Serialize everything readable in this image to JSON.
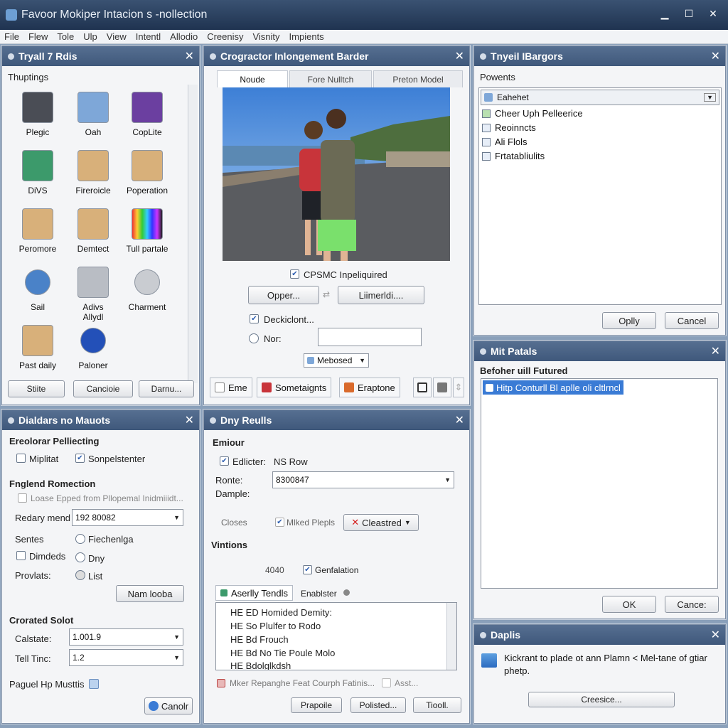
{
  "window": {
    "title": "Favoor Mokiper Intacion s -nollection",
    "minimize": "▁",
    "maximize": "☐",
    "close": "✕"
  },
  "menu": [
    "File",
    "Flew",
    "Tole",
    "Ulp",
    "View",
    "Intentl",
    "Allodio",
    "Creenisy",
    "Visnity",
    "Impients"
  ],
  "colors": {
    "titlebar": "#2a4060",
    "panel_header": "#4a6486",
    "selection": "#3a7bd5"
  },
  "p1": {
    "title": "Tryall 7 Rdis",
    "section": "Thuptings",
    "tiles": [
      {
        "label": "Plegic",
        "icon": "tool-icon",
        "color": "#4a4d55"
      },
      {
        "label": "Oah",
        "icon": "monitor-icon",
        "color": "#7ea7d8"
      },
      {
        "label": "CopLite",
        "icon": "purple-app-icon",
        "color": "#6b3fa0"
      },
      {
        "label": "DiVS",
        "icon": "window-icon",
        "color": "#3c9a6b"
      },
      {
        "label": "Fireroicle",
        "icon": "folder-icon",
        "color": "#d8b07a"
      },
      {
        "label": "Poperation",
        "icon": "folder-icon",
        "color": "#d8b07a"
      },
      {
        "label": "Peromore",
        "icon": "folder-icon",
        "color": "#d8b07a"
      },
      {
        "label": "Demtect",
        "icon": "folder-icon",
        "color": "#d8b07a"
      },
      {
        "label": "Tull partale",
        "icon": "color-bars-icon",
        "color": "#5a6bd8"
      },
      {
        "label": "Sail",
        "icon": "refresh-icon",
        "color": "#4a82c8"
      },
      {
        "label": "Adivs Allydl",
        "icon": "server-icon",
        "color": "#b9bdc4"
      },
      {
        "label": "Charment",
        "icon": "gauge-icon",
        "color": "#c9ccd1"
      },
      {
        "label": "Past daily",
        "icon": "folder-icon",
        "color": "#d8b07a"
      },
      {
        "label": "Paloner",
        "icon": "globe-icon",
        "color": "#2350b8"
      }
    ],
    "buttons": [
      "Stiite",
      "Cancioie",
      "Darnu..."
    ]
  },
  "p2": {
    "title": "Crogractor Inlongement Barder",
    "tabs": [
      "Noude",
      "Fore Nulltch",
      "Preton Model"
    ],
    "check1": "CPSMC Inpeliquired",
    "btn_open": "Opper...",
    "btn_limit": "Liimerldi....",
    "arrows": "⇄",
    "check2": "Deckiclont...",
    "radio_label": "Nor:",
    "combo": "Mebosed",
    "bottom_buttons": [
      {
        "label": "Eme",
        "icon": "page-icon"
      },
      {
        "label": "Sometaignts",
        "icon": "flag-icon"
      },
      {
        "label": "Eraptone",
        "icon": "image-icon"
      }
    ],
    "icon_buttons": [
      "square-icon",
      "printer-icon",
      "expand-icon"
    ]
  },
  "p3": {
    "title": "Tnyeil IBargors",
    "section": "Powents",
    "combo": "Eahehet",
    "tree": [
      "Cheer Uph Pelleerice",
      "Reoinncts",
      "Ali Flols",
      "Frtatabliulits"
    ],
    "buttons": [
      "Oplly",
      "Cancel"
    ]
  },
  "p4": {
    "title": "Mit Patals",
    "section": "Befoher uill Futured",
    "selected_item": "Hitp Conturll Bl aplle oli cltlrncl",
    "buttons": [
      "OK",
      "Cance:"
    ]
  },
  "p5": {
    "title": "Daplis",
    "message": "Kickrant to plade ot ann Plamn < Mel-tane of gtiar phetp.",
    "button": "Creesice..."
  },
  "p6": {
    "title": "Dialdars no Mauots",
    "group1_title": "Ereolorar Pelliecting",
    "cb1": "Miplitat",
    "cb2": "Sonpelstenter",
    "section2": "Fnglend Romection",
    "disabled_check": "Loase Epped from Pllopemal Inidmiiidt...",
    "redary_label": "Redary mend",
    "redary_value": "192 80082",
    "sentes": "Sentes",
    "fiechenia": "Fiechenlga",
    "dimdeds": "Dimdeds",
    "dny": "Dny",
    "provlats": "Provlats:",
    "list": "List",
    "btn_name": "Nam looba",
    "section3": "Crorated Solot",
    "calc_label": "Calstate:",
    "calc_value": "1.001.9",
    "tell_label": "Tell Tinc:",
    "tell_value": "1.2",
    "paguel": "Paguel Hp Musttis",
    "btn_cancel": "Canolr"
  },
  "p7": {
    "title": "Dny Reulls",
    "group_title": "Emiour",
    "cb_editor": "Edlicter:",
    "ns_row": "NS Row",
    "ronte": "Ronte:",
    "dample": "Dample:",
    "combo_value": "8300847",
    "closes": "Closes",
    "mixed": "Mlked Plepls",
    "created": "Cleastred",
    "section": "Vintions",
    "code": "4040",
    "cb_gen": "Genfalation",
    "tabs": [
      "Aserlly Tendls",
      "Enablster"
    ],
    "list": [
      "HE ED Homided Demity:",
      "HE So Plulfer to Rodo",
      "HE Bd Frouch",
      "HE Bd No Tie Poule Molo",
      "HE Bdolglkdsh"
    ],
    "footer_check": "Mker Repanghe Feat Courph Fatinis...",
    "footer_check2": "Asst...",
    "buttons": [
      "Prapoile",
      "Polisted...",
      "Tiooll."
    ]
  }
}
